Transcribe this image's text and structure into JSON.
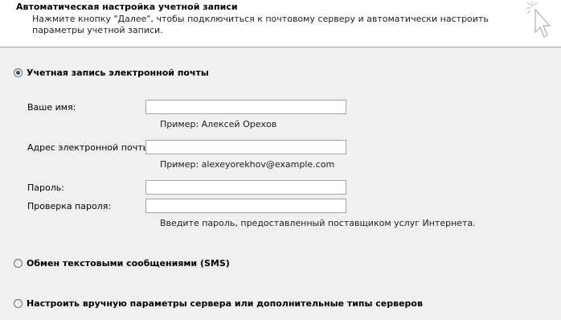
{
  "header": {
    "title": "Автоматическая настройка учетной записи",
    "description": "Нажмите кнопку \"Далее\", чтобы подключиться к почтовому серверу и автоматически настроить параметры учетной записи.",
    "icon": "wizard-cursor-icon"
  },
  "options": {
    "email_account": {
      "label": "Учетная запись электронной почты",
      "checked": true
    },
    "sms": {
      "label": "Обмен текстовыми сообщениями (SMS)",
      "checked": false
    },
    "manual": {
      "label": "Настроить вручную параметры сервера или дополнительные типы серверов",
      "checked": false
    }
  },
  "form": {
    "name": {
      "label": "Ваше имя:",
      "value": "",
      "hint": "Пример: Алексей Орехов"
    },
    "email": {
      "label": "Адрес электронной почты:",
      "value": "",
      "hint": "Пример: alexeyorekhov@example.com"
    },
    "password": {
      "label": "Пароль:",
      "value": ""
    },
    "password_confirm": {
      "label": "Проверка пароля:",
      "value": "",
      "hint": "Введите пароль, предоставленный поставщиком услуг Интернета."
    }
  }
}
